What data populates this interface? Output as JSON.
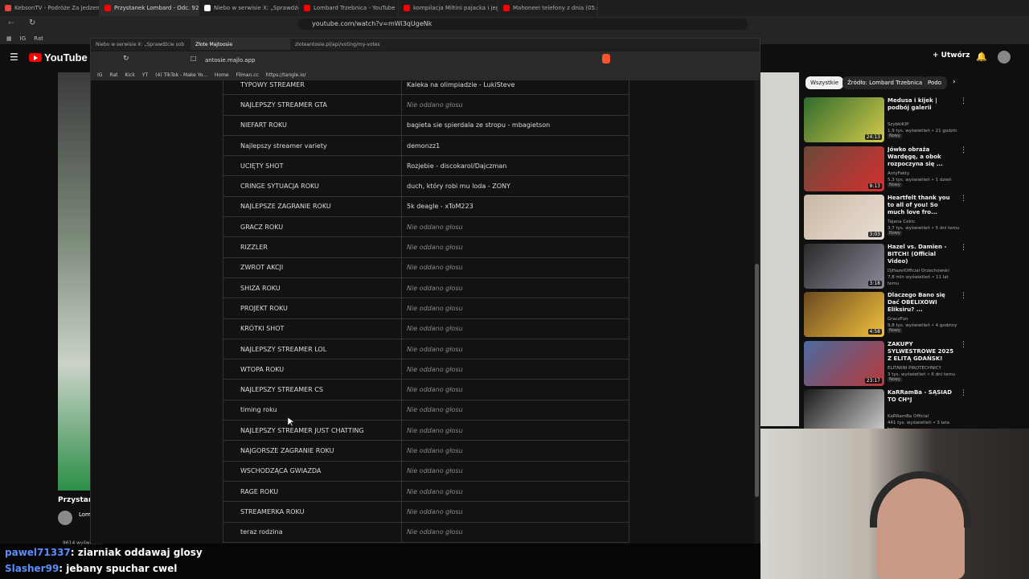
{
  "outer_tabs": [
    {
      "label": "KebsonTV - Podróże Za Jedzeniem",
      "color": "#e8453c"
    },
    {
      "label": "Przystanek Lombard - Odc. 92",
      "color": "#ff0000",
      "active": true
    },
    {
      "label": "Niebo w serwisie X: „Sprawdźcie sob",
      "color": "#ffffff"
    },
    {
      "label": "Lombard Trzebnica - YouTube",
      "color": "#ff0000"
    },
    {
      "label": "kompilacja Miltini pajacka i jego ko",
      "color": "#ff0000"
    },
    {
      "label": "Mahoneei telefony z dnia (05.01.26) -",
      "color": "#ff0000"
    }
  ],
  "outer_url": "youtube.com/watch?v=mWi3qUgeNk",
  "outer_bookmarks": [
    "IG",
    "Rat"
  ],
  "youtube": {
    "logo": "YouTube",
    "country": "PL",
    "create_label": "+ Utwórz",
    "chips": [
      "Wszystkie",
      "Źródło: Lombard Trzebnica",
      "Podo"
    ],
    "video_title_partial": "Przystan",
    "channel_partial": "Lom",
    "views_partial": "9614 wyświetleń"
  },
  "recommendations": [
    {
      "title": "Medusa i kijek | podbój galerii",
      "channel": "SzybkiKIP",
      "meta": "1,9 tys. wyświetleń • 21 godzin te",
      "badge": "Nowy",
      "duration": "24:13",
      "c1": "#2f6b2e",
      "c2": "#d4c94a"
    },
    {
      "title": "Jówko obraża Wardęgę, a obok rozpoczyna się ...",
      "channel": "AntyFakty",
      "meta": "5,3 tys. wyświetleń • 1 dzień temu",
      "badge": "Nowy",
      "duration": "8:13",
      "c1": "#6a4a3a",
      "c2": "#d42f2f"
    },
    {
      "title": "Heartfelt thank you to all of you! So much love fro...",
      "channel": "Tajana Cekic",
      "meta": "3,7 tys. wyświetleń • 5 dni temu",
      "badge": "Nowy",
      "duration": "3:03",
      "c1": "#c9b6a3",
      "c2": "#eae0d5"
    },
    {
      "title": "Hazel vs. Damien - BITCH! (Official Video)",
      "channel": "DjHazelOfficial Orzechowski",
      "meta": "7,8 mln wyświetleń • 11 lat temu",
      "badge": "",
      "duration": "3:18",
      "c1": "#2a2a2a",
      "c2": "#8b8a9a"
    },
    {
      "title": "Dlaczego Bano się Dać OBELIXOWI Eliksiru? ...",
      "channel": "GraczFun",
      "meta": "9,8 tys. wyświetleń • 4 godziny te",
      "badge": "Nowy",
      "duration": "4:58",
      "c1": "#6b4a1e",
      "c2": "#f0c040"
    },
    {
      "title": "ZAKUPY SYLWESTROWE 2025 Z ELITĄ GDAŃSK!",
      "channel": "ELITARNI PIROTECHNICY",
      "meta": "3 tys. wyświetleń • 6 dni temu",
      "badge": "Nowy",
      "duration": "23:17",
      "c1": "#4a6aa0",
      "c2": "#b83a3a"
    },
    {
      "title": "KaRRamBa - SĄSIAD TO CH*J",
      "channel": "KaRRamBa Official",
      "meta": "441 tys. wyświetleń • 3 lata temu",
      "badge": "",
      "duration": "",
      "c1": "#1a1a1a",
      "c2": "#cfcfcf"
    }
  ],
  "inner_tabs": [
    {
      "label": "Niebo w serwisie X: „Sprawdźcie sob",
      "active": false
    },
    {
      "label": "Złote Majtoosie",
      "active": true
    },
    {
      "label": "zloteantosie.pl/api/voting/my-votes",
      "active": false
    }
  ],
  "inner_url": "antosie.majlo.app",
  "inner_bookmarks": [
    "IG",
    "Rat",
    "Kick",
    "YT",
    "(4) TikTok - Make Yo...",
    "Home",
    "Filman.cc",
    "https://tangle.io/"
  ],
  "votes": [
    {
      "category": "TYPOWY STREAMER",
      "vote": "Kaleka na olimpiadzie - LukiSteve"
    },
    {
      "category": "NAJLEPSZY STREAMER GTA",
      "vote": "Nie oddano głosu"
    },
    {
      "category": "NIEFART ROKU",
      "vote": "bagieta sie spierdala ze stropu - mbagietson"
    },
    {
      "category": "Najlepszy streamer variety",
      "vote": "demonzz1"
    },
    {
      "category": "UCIĘTY SHOT",
      "vote": "Rozjebie - discokarol/Dajczman"
    },
    {
      "category": "CRINGE SYTUACJA ROKU",
      "vote": "duch, który robi mu loda - ZONY"
    },
    {
      "category": "NAJLEPSZE ZAGRANIE ROKU",
      "vote": "5k deagle - xToM223"
    },
    {
      "category": "GRACZ ROKU",
      "vote": "Nie oddano głosu"
    },
    {
      "category": "RIZZLER",
      "vote": "Nie oddano głosu"
    },
    {
      "category": "ZWROT AKCJI",
      "vote": "Nie oddano głosu"
    },
    {
      "category": "SHIZA ROKU",
      "vote": "Nie oddano głosu"
    },
    {
      "category": "PROJEKT ROKU",
      "vote": "Nie oddano głosu"
    },
    {
      "category": "KRÓTKI SHOT",
      "vote": "Nie oddano głosu"
    },
    {
      "category": "NAJLEPSZY STREAMER LOL",
      "vote": "Nie oddano głosu"
    },
    {
      "category": "WTOPA ROKU",
      "vote": "Nie oddano głosu"
    },
    {
      "category": "NAJLEPSZY STREAMER CS",
      "vote": "Nie oddano głosu"
    },
    {
      "category": "timing roku",
      "vote": "Nie oddano głosu"
    },
    {
      "category": "NAJLEPSZY STREAMER JUST CHATTING",
      "vote": "Nie oddano głosu"
    },
    {
      "category": "NAJGORSZE ZAGRANIE ROKU",
      "vote": "Nie oddano głosu"
    },
    {
      "category": "WSCHODZĄCA GWIAZDA",
      "vote": "Nie oddano głosu"
    },
    {
      "category": "RAGE ROKU",
      "vote": "Nie oddano głosu"
    },
    {
      "category": "STREAMERKA ROKU",
      "vote": "Nie oddano głosu"
    },
    {
      "category": "teraz rodzina",
      "vote": "Nie oddano głosu"
    }
  ],
  "empty_vote_text": "Nie oddano głosu",
  "chat": [
    {
      "user": "pawel71337",
      "message": ": ziarniak oddawaj glosy"
    },
    {
      "user": "Slasher99",
      "message": ": jebany spuchar cwel"
    }
  ]
}
